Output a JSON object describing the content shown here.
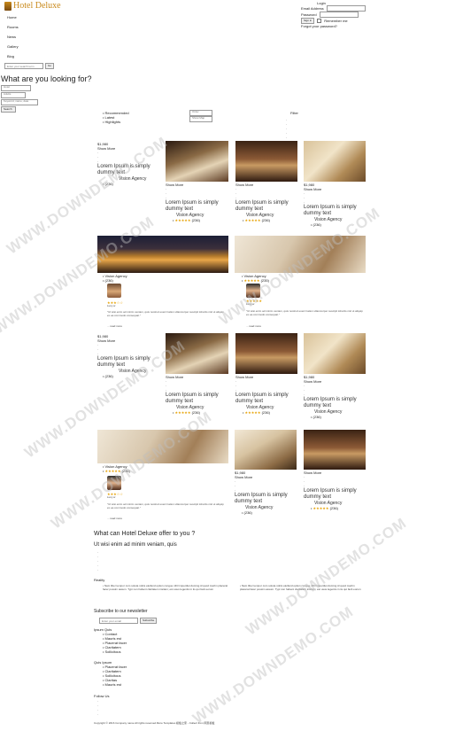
{
  "brand": {
    "name": "Hotel Deluxe"
  },
  "nav": {
    "items": [
      "Home",
      "Rooms",
      "News",
      "Gallery",
      "Blog"
    ]
  },
  "search": {
    "placeholder": "Enter your search term",
    "button": "Go"
  },
  "hero": {
    "headline": "What are you looking for?"
  },
  "filters": {
    "selects": [
      "Hotel",
      "Adults",
      "Keyword, name, date"
    ],
    "search_button": "Search"
  },
  "login": {
    "title": "Login",
    "email_label": "Email Address",
    "password_label": "Password",
    "sign_in": "Sign in",
    "remember": "Remember me",
    "forgot": "Forgot your password?"
  },
  "sort": {
    "options": [
      "Recommended",
      "Latest",
      "Highlights"
    ],
    "select_order": "Order",
    "select_show": "Show Map",
    "filter_label": "Filter"
  },
  "listing": {
    "title": "Lorem Ipsum is simply dummy text",
    "agency": "Vision Agency",
    "price": "$1,980",
    "show_more": "Show More",
    "rating_count": "(236)",
    "rating_count_b": "(235)",
    "stars": "★★★★★"
  },
  "reviews": {
    "name": "Lucy w",
    "text": "\"Ut wisi enim ad minim veniam, quis nostrud exerci tation ullamcorper suscipit lobortis nisl ut aliquip ex ea commodo consequat.\"",
    "read_more": "... read more"
  },
  "offer": {
    "title": "What can Hotel Deluxe offer to you ?",
    "subtitle": "Ut wisi enim ad minim veniam, quis"
  },
  "reality": {
    "title": "Reality",
    "items": [
      "Nam liber tempor cum soluta nobis eleifend option congue nihil imperdiet doming id quod mazim placerat facer possim assum. Typi non habent claritatem insitam; est usus legentis in iis qui facit eorum",
      "Nam liber tempor cum soluta nobis eleifend option congue nihil imperdiet doming id quod mazim placerat facer possim assum. Typi non habent claritatem insitam; est usus legentis in iis qui facit eorum"
    ]
  },
  "newsletter": {
    "title": "Subscribe to our newsletter",
    "placeholder": "Enter your email",
    "button": "Subscribe"
  },
  "footer": {
    "col1_title": "Ipsum Quis",
    "col1": [
      "Contact",
      "Mauris est",
      "Placerat facer",
      "Claritatem",
      "Sollicitous"
    ],
    "col2_title": "Quis Ipsum",
    "col2": [
      "Placerat facer",
      "Claritatem",
      "Sollicitous",
      "Claritas",
      "Mauris est"
    ],
    "follow": "Follow Us",
    "copyright": "Copyright © 2016 Company name All rights reserved.More Templates 模板之家 - Collect from 网页模板"
  },
  "watermark": "WWW.DOWNDEMO.COM",
  "colors": {
    "brand": "#c8891b",
    "stars": "#e6a100"
  }
}
